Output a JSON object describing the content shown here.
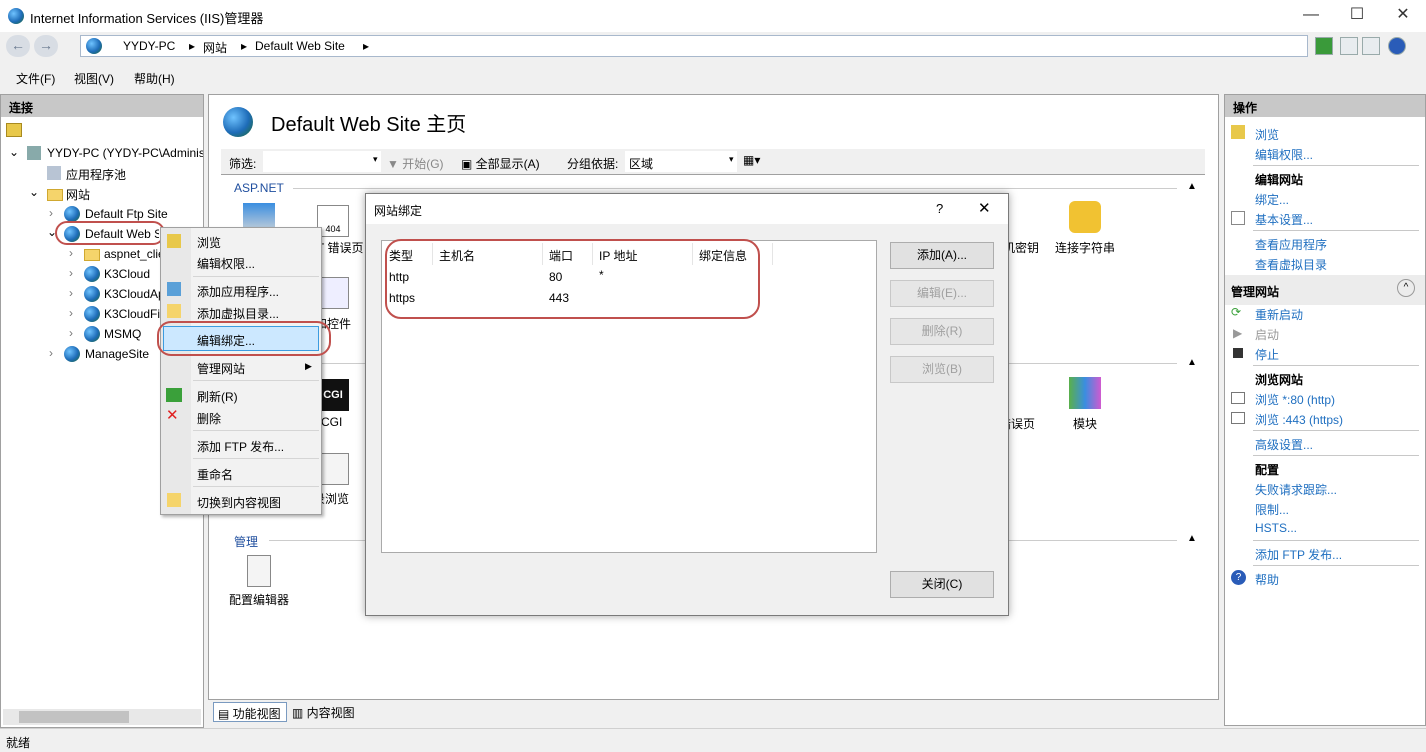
{
  "window": {
    "title": "Internet Information Services (IIS)管理器",
    "minimize": "—",
    "maximize": "☐",
    "close": "✕"
  },
  "address": {
    "back": "←",
    "forward": "→",
    "crumbs": [
      "YYDY-PC",
      "网站",
      "Default Web Site"
    ],
    "sep": "▸"
  },
  "menu": [
    "文件(F)",
    "视图(V)",
    "帮助(H)"
  ],
  "connections": {
    "title": "连接",
    "tree": {
      "root": "YYDY-PC (YYDY-PC\\Administrator)",
      "app_pools": "应用程序池",
      "sites": "网站",
      "ftp": "Default Ftp Site",
      "web": "Default Web Site",
      "children": [
        "aspnet_client",
        "K3Cloud",
        "K3CloudApp",
        "K3CloudFile",
        "MSMQ"
      ],
      "manage": "ManageSite"
    }
  },
  "context_menu": {
    "items": [
      "浏览",
      "编辑权限...",
      "添加应用程序...",
      "添加虚拟目录...",
      "编辑绑定...",
      "管理网站",
      "刷新(R)",
      "删除",
      "添加 FTP 发布...",
      "重命名",
      "切换到内容视图"
    ],
    "highlighted": "编辑绑定..."
  },
  "center": {
    "title": "Default Web Site 主页",
    "filter_label": "筛选:",
    "start": "开始(G)",
    "show_all": "全部显示(A)",
    "group_by_label": "分组依据:",
    "group_by_value": "区域",
    "groups": {
      "aspnet": "ASP.NET",
      "manage": "管理"
    },
    "icons": {
      "net_error": ".NET 错误页",
      "pages_controls": "页面和控件",
      "cgi": "CGI",
      "dir_browse": "目录浏览",
      "machine_key": "计算机密钥",
      "conn_strings": "连接字符串",
      "error_pages": "错误页",
      "modules": "模块",
      "config_editor": "配置编辑器"
    },
    "cgi_badge": "CGI",
    "e404": "404"
  },
  "dialog": {
    "title": "网站绑定",
    "help": "?",
    "close_x": "✕",
    "columns": [
      "类型",
      "主机名",
      "端口",
      "IP 地址",
      "绑定信息"
    ],
    "rows": [
      {
        "type": "http",
        "host": "",
        "port": "80",
        "ip": "*",
        "info": ""
      },
      {
        "type": "https",
        "host": "",
        "port": "443",
        "ip": "",
        "info": ""
      }
    ],
    "buttons": {
      "add": "添加(A)...",
      "edit": "编辑(E)...",
      "remove": "删除(R)",
      "browse": "浏览(B)",
      "close": "关闭(C)"
    }
  },
  "actions": {
    "title": "操作",
    "browse": "浏览",
    "edit_perm": "编辑权限...",
    "edit_site": "编辑网站",
    "bindings": "绑定...",
    "basic": "基本设置...",
    "view_apps": "查看应用程序",
    "view_vdirs": "查看虚拟目录",
    "manage_site": "管理网站",
    "restart": "重新启动",
    "start": "启动",
    "stop": "停止",
    "browse_site": "浏览网站",
    "browse80": "浏览 *:80 (http)",
    "browse443": "浏览 :443 (https)",
    "advanced": "高级设置...",
    "config": "配置",
    "failed_req": "失败请求跟踪...",
    "limits": "限制...",
    "hsts": "HSTS...",
    "add_ftp": "添加 FTP 发布...",
    "help": "帮助"
  },
  "bottom_tabs": [
    "功能视图",
    "内容视图"
  ],
  "status": "就绪",
  "colors": {
    "accent_link": "#1f6fc0",
    "highlight_ring": "#c0504d",
    "menu_highlight": "#cce8ff"
  }
}
